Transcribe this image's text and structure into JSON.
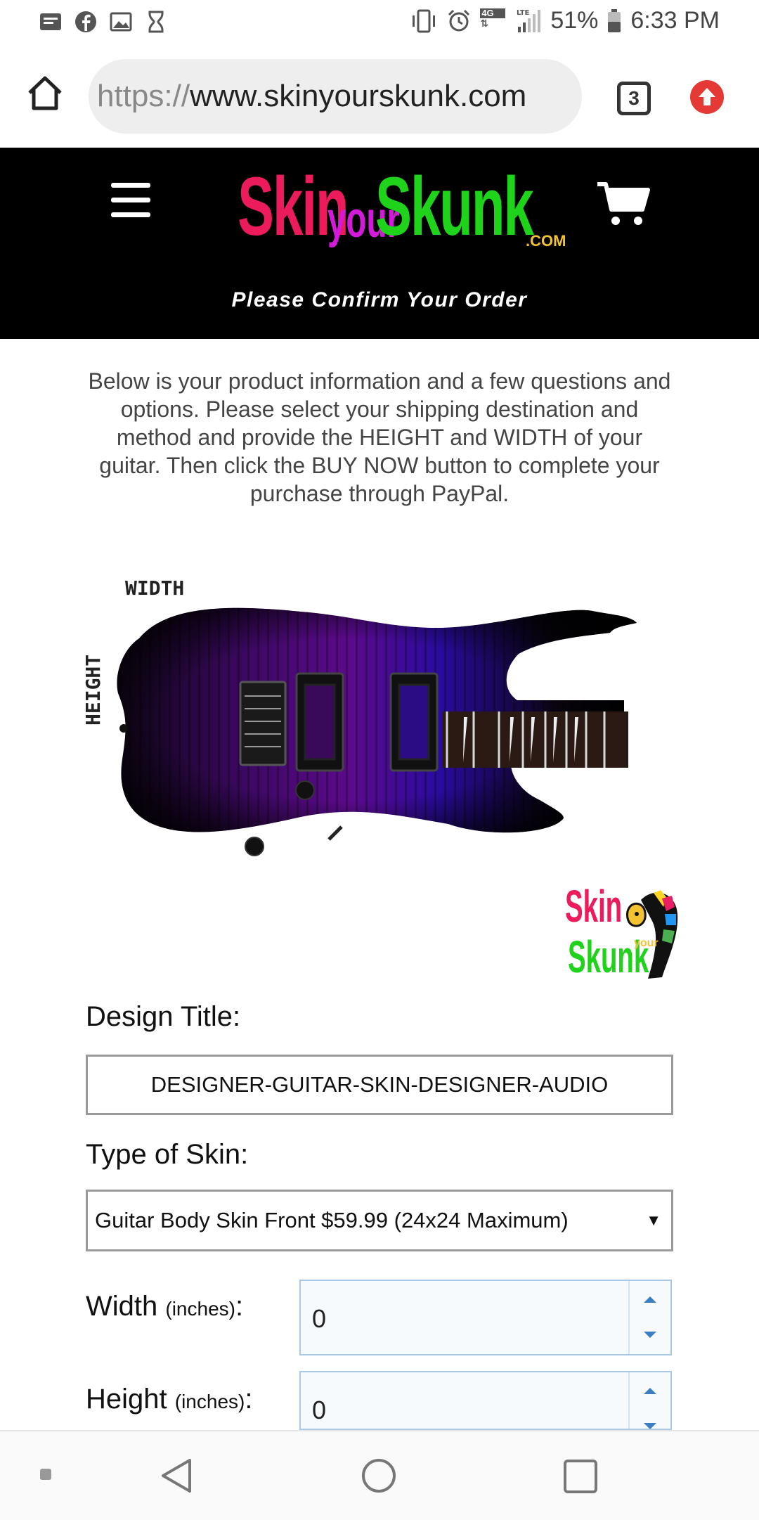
{
  "status_bar": {
    "battery": "51%",
    "time": "6:33 PM",
    "network": "4G",
    "network_lte": "LTE",
    "icons_left": [
      "notification-icon",
      "facebook-icon",
      "image-icon",
      "hourglass-icon"
    ],
    "icons_right": [
      "vibrate-icon",
      "alarm-icon",
      "signal-icon",
      "battery-icon"
    ]
  },
  "browser": {
    "url_scheme": "https://",
    "url_host": "www.skinyourskunk.com",
    "tab_count": "3"
  },
  "header": {
    "logo": {
      "skin": "Skin",
      "your": "your",
      "skunk": "Skunk",
      "com": ".COM"
    },
    "page_heading": "Please Confirm Your Order"
  },
  "intro": {
    "text": "Below is your product information and a few questions and options. Please select your shipping destination and method and provide the HEIGHT and WIDTH of your guitar.  Then click the BUY NOW button to complete your purchase through PayPal."
  },
  "guitar": {
    "width_label": "WIDTH",
    "height_label": "HEIGHT",
    "badge_skin": "Skin",
    "badge_your": "your",
    "badge_skunk": "Skunk"
  },
  "form": {
    "design_title_label": "Design Title:",
    "design_title_value": "DESIGNER-GUITAR-SKIN-DESIGNER-AUDIO",
    "skin_type_label": "Type of Skin:",
    "skin_type_value": "Guitar Body Skin Front $59.99 (24x24 Maximum)",
    "width_label": "Width",
    "width_unit": "(inches)",
    "width_value": "0",
    "height_label": "Height",
    "height_unit": "(inches)",
    "height_value": "0",
    "colon": ":"
  },
  "colors": {
    "logo_pink": "#ec1b5b",
    "logo_magenta": "#d41ad9",
    "logo_green": "#1fd31b",
    "logo_gold": "#f2c230",
    "guitar_purple": "#5b0a8c",
    "spinner_blue": "#3b7ec4"
  }
}
